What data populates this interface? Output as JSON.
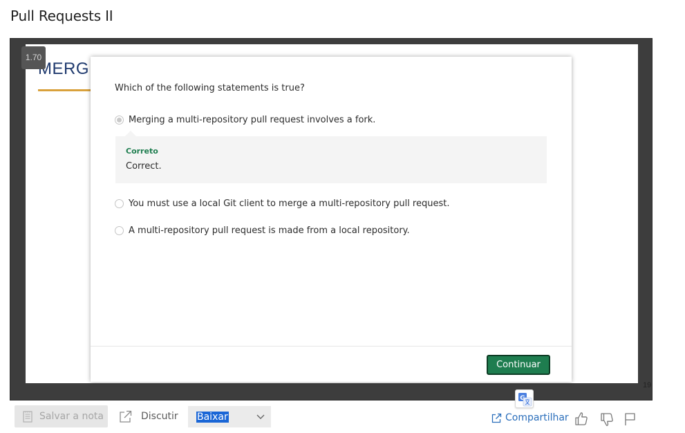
{
  "page": {
    "title": "Pull Requests II"
  },
  "player": {
    "speed": "1.70",
    "slide_heading": "MERG",
    "slide_number": "19"
  },
  "quiz": {
    "question": "Which of the following statements is true?",
    "options": [
      {
        "label": "Merging a multi-repository pull request involves a fork.",
        "selected": true
      },
      {
        "label": "You must use a local Git client to merge a multi-repository pull request.",
        "selected": false
      },
      {
        "label": "A multi-repository pull request is made from a local repository.",
        "selected": false
      }
    ],
    "feedback": {
      "title": "Correto",
      "text": "Correct."
    },
    "continue_label": "Continuar"
  },
  "toolbar": {
    "save_note_label": "Salvar a nota",
    "discuss_label": "Discutir",
    "download_selected": "Baixar",
    "share_label": "Compartilhar"
  },
  "colors": {
    "accent_green": "#1e7d4f",
    "link_blue": "#2a6ebb",
    "selection_blue": "#1a66d6"
  }
}
